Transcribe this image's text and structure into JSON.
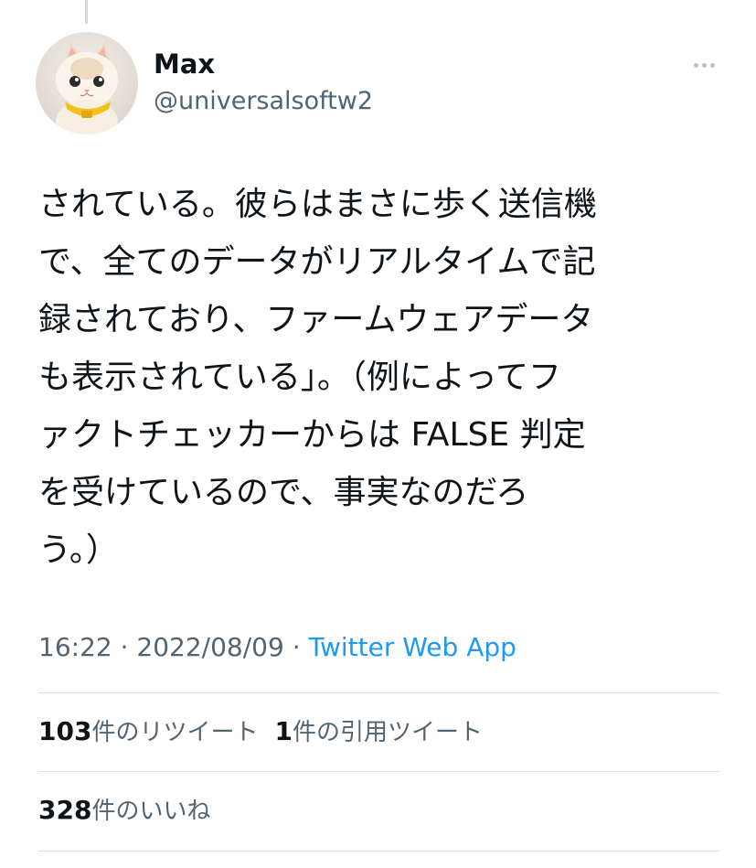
{
  "tweet": {
    "author_name": "Max",
    "author_handle": "@universalsoftw2",
    "text": "されている。彼らはまさに歩く送信機\nで、全てのデータがリアルタイムで記\n録されており、ファームウェアデータ\nも表示されている」。（例によってフ\nァクトチェッカーからは FALSE 判定\nを受けているので、事実なのだろ\nう。）",
    "time": "16:22",
    "date": "2022/08/09",
    "separator": " · ",
    "source_app": "Twitter Web App"
  },
  "stats": {
    "retweets_count": "103",
    "retweets_label": "件のリツイート",
    "quotes_count": "1",
    "quotes_label": "件の引用ツイート",
    "likes_count": "328",
    "likes_label": "件のいいね"
  },
  "icons": {
    "more": "more-horizontal-icon",
    "avatar": "kitten-avatar"
  },
  "colors": {
    "link": "#1d9bf0",
    "secondary_text": "#536471",
    "primary_text": "#0f1419"
  }
}
